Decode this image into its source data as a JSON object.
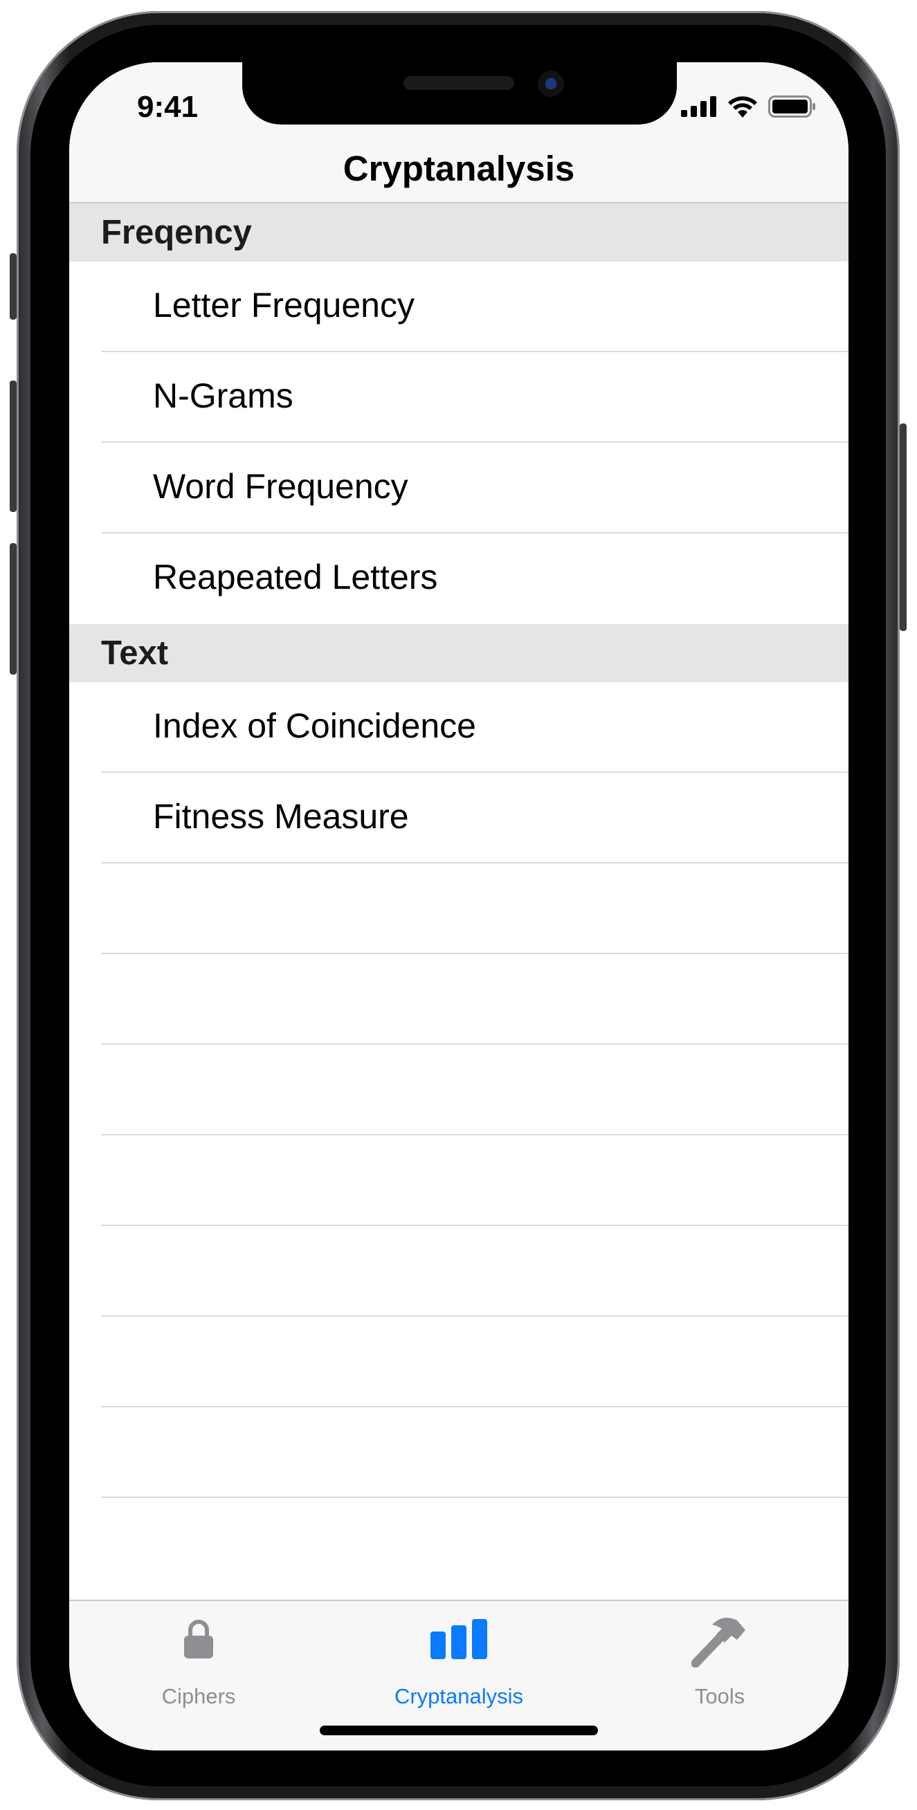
{
  "status_bar": {
    "time": "9:41"
  },
  "navigation": {
    "title": "Cryptanalysis"
  },
  "sections": [
    {
      "header": "Freqency",
      "items": [
        "Letter Frequency",
        "N-Grams",
        "Word Frequency",
        "Reapeated Letters"
      ]
    },
    {
      "header": "Text",
      "items": [
        "Index of Coincidence",
        "Fitness Measure"
      ]
    }
  ],
  "tab_bar": {
    "tabs": [
      {
        "label": "Ciphers",
        "icon": "lock-icon",
        "selected": false
      },
      {
        "label": "Cryptanalysis",
        "icon": "bar-chart-icon",
        "selected": true
      },
      {
        "label": "Tools",
        "icon": "hammer-icon",
        "selected": false
      }
    ]
  },
  "colors": {
    "accent": "#0a7aff",
    "inactive_tab": "#8e8e93",
    "section_header_bg": "#e5e5e6",
    "bar_bg": "#f7f7f7"
  }
}
